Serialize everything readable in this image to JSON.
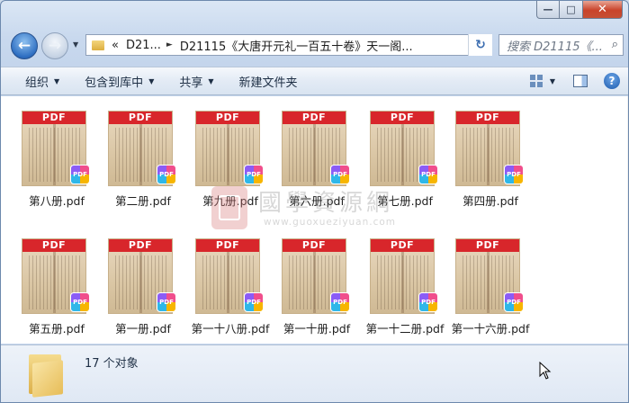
{
  "window": {
    "caption_buttons": {
      "minimize": "—",
      "maximize": "□",
      "close": "✕"
    }
  },
  "nav": {
    "back_glyph": "←",
    "forward_glyph": "→",
    "address": {
      "prefix": "«",
      "root": "D21...",
      "current": "D21115《大唐开元礼一百五十卷》天一阁..."
    },
    "refresh_glyph": "↻",
    "search_placeholder": "搜索 D21115《...",
    "search_icon": "⌕"
  },
  "toolbar": {
    "organize": "组织",
    "include_in_library": "包含到库中",
    "share": "共享",
    "new_folder": "新建文件夹",
    "help_glyph": "?"
  },
  "files": [
    {
      "name": "第八册.pdf",
      "badge": "PDF"
    },
    {
      "name": "第二册.pdf",
      "badge": "PDF"
    },
    {
      "name": "第九册.pdf",
      "badge": "PDF"
    },
    {
      "name": "第六册.pdf",
      "badge": "PDF"
    },
    {
      "name": "第七册.pdf",
      "badge": "PDF"
    },
    {
      "name": "第四册.pdf",
      "badge": "PDF"
    },
    {
      "name": "第五册.pdf",
      "badge": "PDF"
    },
    {
      "name": "第一册.pdf",
      "badge": "PDF"
    },
    {
      "name": "第一十八册.pdf",
      "badge": "PDF"
    },
    {
      "name": "第一十册.pdf",
      "badge": "PDF"
    },
    {
      "name": "第一十二册.pdf",
      "badge": "PDF"
    },
    {
      "name": "第一十六册.pdf",
      "badge": "PDF"
    }
  ],
  "thumb_band_label": "PDF",
  "watermark": {
    "title": "國學資源網",
    "url": "www.guoxueziyuan.com"
  },
  "status": {
    "count_text": "17 个对象"
  },
  "colors": {
    "pdf_red": "#d8262b",
    "accent_blue": "#2f6fc2"
  }
}
